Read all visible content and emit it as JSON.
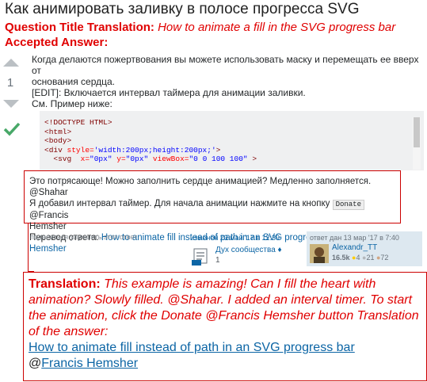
{
  "question": {
    "title": "Как анимировать заливку в полосе прогресса SVG",
    "title_translation_label": "Question Title Translation:",
    "title_translation_text": "How to animate a fill in the SVG progress bar",
    "accepted_label": "Accepted Answer:"
  },
  "answer": {
    "score": "1",
    "text_line1": "Когда делаются пожертвования вы можете использовать маску и перемещать ее вверх от",
    "text_line2": "основания сердца.",
    "text_line3": "[EDIT]: Включается интервал таймера для анимации заливки.",
    "text_line4": "См. Пример ниже:",
    "code": {
      "l1": "<!DOCTYPE HTML>",
      "l2": "<html>",
      "l3": "<body>",
      "l4_tag_open": "<div",
      "l4_attr": "style=",
      "l4_val": "'width:200px;height:200px;'",
      "l4_close": ">",
      "l5_tag_open": "<svg",
      "l5_attr1": "x=",
      "l5_val1": "\"0px\"",
      "l5_attr2": "y=",
      "l5_val2": "\"0px\"",
      "l5_attr3": "viewBox=",
      "l5_val3": "\"0 0 100 100\"",
      "l5_close": ">"
    },
    "actions": "поделиться улучшить этот ответ",
    "editor": {
      "when": "изменён 23 май '17 в 12:39",
      "name": "Дух сообщества ♦",
      "num": "1"
    },
    "owner": {
      "when": "ответ дан 13 мар '17 в 7:40",
      "name": "Alexandr_TT",
      "rep": "16.5k",
      "gold": "4",
      "silver": "21",
      "bronze": "72"
    }
  },
  "comment": {
    "line1": "Это потрясающе! Можно заполнить сердце анимацией? Медленно заполняется. @Shahar",
    "line2_pre": "Я добавил интервал таймер. Для начала анимации нажмите на кнопку",
    "line2_kbd": "Donate",
    "line2_post": "@Francis",
    "line3": "Hemsher",
    "line4_pre": "Перевод ответа:",
    "line4_link": "How to animate fill instead of path in an SVG progress bar",
    "line4_mention": "@Francis Hemsher"
  },
  "translation": {
    "label": "Translation:",
    "text": "This example is amazing! Can I fill the heart with animation? Slowly filled. @Shahar. I added an interval timer. To start the animation, click the Donate @Francis Hemsher button Translation of the answer:",
    "link": "How to animate fill instead of path in an SVG progress bar",
    "at": "@",
    "mention": "Francis Hemsher"
  }
}
